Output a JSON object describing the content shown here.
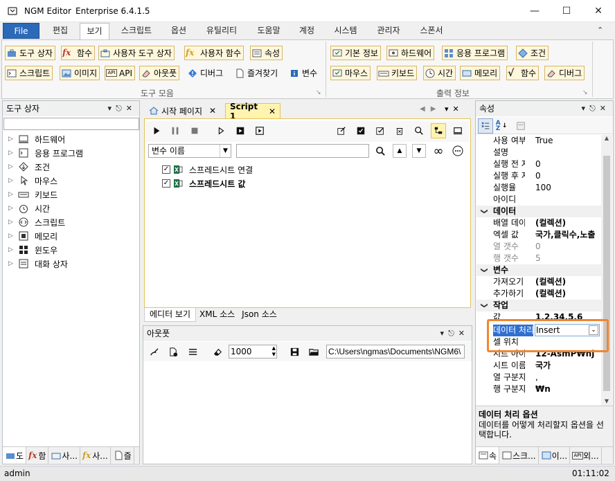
{
  "window": {
    "app_name": "NGM Editor",
    "edition": "Enterprise 6.4.1.5"
  },
  "menu": [
    "File",
    "편집",
    "보기",
    "스크립트",
    "옵션",
    "유틸리티",
    "도움말",
    "계정",
    "시스템",
    "관리자",
    "스폰서"
  ],
  "ribbon": {
    "group1_row1": [
      "도구 상자",
      "함수",
      "사용자 도구 상자",
      "사용자 함수",
      "속성"
    ],
    "group1_row2": [
      "스크립트",
      "이미지",
      "API",
      "아웃풋",
      "디버그",
      "즐겨찾기",
      "변수"
    ],
    "group1_label": "도구 모음",
    "group2_row1": [
      "기본 정보",
      "하드웨어",
      "응용 프로그램",
      "조건"
    ],
    "group2_row2": [
      "마우스",
      "키보드",
      "시간",
      "메모리",
      "함수",
      "디버그"
    ],
    "group2_label": "출력 정보"
  },
  "toolbox": {
    "title": "도구 상자",
    "search_value": "",
    "items": [
      "하드웨어",
      "응용 프로그램",
      "조건",
      "마우스",
      "키보드",
      "시간",
      "스크립트",
      "메모리",
      "윈도우",
      "대화 상자"
    ],
    "bottom_tabs": [
      "도",
      "함",
      "사...",
      "사...",
      "즐"
    ]
  },
  "editor": {
    "tabs": [
      "시작 페이지",
      "Script 1"
    ],
    "variable_select": "변수 이름",
    "variable_search": "",
    "script_items": [
      {
        "label": "스프레드시트 연결",
        "checked": true,
        "bold": false
      },
      {
        "label": "스프레드시트 값",
        "checked": true,
        "bold": true
      }
    ],
    "view_tabs": [
      "에디터 보기",
      "XML 소스",
      "Json 소스"
    ]
  },
  "output": {
    "title": "아웃풋",
    "count_value": "1000",
    "path_value": "C:\\Users\\ngmas\\Documents\\NGM6\\"
  },
  "properties": {
    "title": "속성",
    "rows": [
      {
        "type": "prop",
        "name": "사용 여부",
        "value": "True"
      },
      {
        "type": "prop",
        "name": "설명",
        "value": ""
      },
      {
        "type": "prop",
        "name": "실행 전 지",
        "value": "0"
      },
      {
        "type": "prop",
        "name": "실행 후 지",
        "value": "0"
      },
      {
        "type": "prop",
        "name": "실행율",
        "value": "100"
      },
      {
        "type": "prop",
        "name": "아이디",
        "value": ""
      },
      {
        "type": "cat",
        "name": "데이터"
      },
      {
        "type": "prop",
        "name": "배열 데이터",
        "value": "(컬렉션)",
        "bold": true
      },
      {
        "type": "prop",
        "name": "엑셀 값",
        "value": "국가,클릭수,노출",
        "bold": true
      },
      {
        "type": "prop",
        "name": "열 갯수",
        "value": "0",
        "gray": true
      },
      {
        "type": "prop",
        "name": "행 갯수",
        "value": "5",
        "gray": true
      },
      {
        "type": "cat",
        "name": "변수"
      },
      {
        "type": "prop",
        "name": "가져오기",
        "value": "(컬렉션)",
        "bold": true
      },
      {
        "type": "prop",
        "name": "추가하기",
        "value": "(컬렉션)",
        "bold": true
      },
      {
        "type": "cat",
        "name": "작업"
      },
      {
        "type": "prop",
        "name": "값",
        "value": "1,2,34,5,6",
        "bold": true
      },
      {
        "type": "selected",
        "name": "데이터 처리",
        "value": "Insert"
      },
      {
        "type": "prop",
        "name": "셀 위치",
        "value": ""
      },
      {
        "type": "prop",
        "name": "시트 아이디",
        "value": "12-AsmP₩nj",
        "bold": true
      },
      {
        "type": "prop",
        "name": "시트 이름",
        "value": "국가",
        "bold": true
      },
      {
        "type": "prop",
        "name": "열 구분자",
        "value": ","
      },
      {
        "type": "prop",
        "name": "행 구분자",
        "value": "₩n",
        "bold": true
      }
    ],
    "desc_title": "데이터 처리 옵션",
    "desc_text": "데이터를 어떻게 처리할지 옵션을 선택합니다.",
    "bottom_tabs": [
      "속",
      "스크...",
      "이...",
      "외..."
    ]
  },
  "status": {
    "user": "admin",
    "time": "01:11:02"
  },
  "colors": {
    "accent": "#2b6ab8",
    "highlight_box": "#f0862f",
    "selected_row": "#2f6fd1"
  }
}
